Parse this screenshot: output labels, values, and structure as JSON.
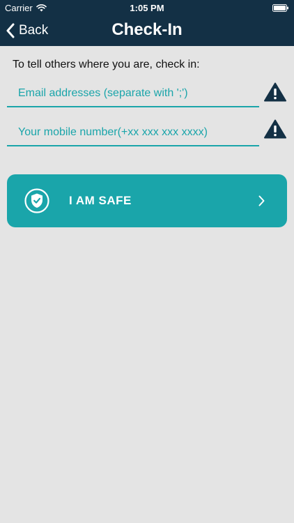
{
  "status_bar": {
    "carrier": "Carrier",
    "time": "1:05 PM"
  },
  "header": {
    "back_label": "Back",
    "title": "Check-In"
  },
  "main": {
    "instructions": "To tell others where you are, check in:",
    "email_field": {
      "value": "",
      "placeholder": "Email addresses (separate with ';')"
    },
    "phone_field": {
      "value": "",
      "placeholder": "Your mobile number(+xx xxx xxx xxxx)"
    },
    "safe_button": {
      "label": "I AM SAFE"
    }
  },
  "icons": {
    "wifi": "wifi-icon",
    "battery": "battery-icon",
    "back": "chevron-left-icon",
    "warning": "warning-icon",
    "shield": "shield-check-icon",
    "forward": "chevron-right-icon"
  },
  "colors": {
    "header_bg": "#133045",
    "accent": "#1aa5aa",
    "background": "#e4e4e4",
    "warning": "#133045"
  }
}
